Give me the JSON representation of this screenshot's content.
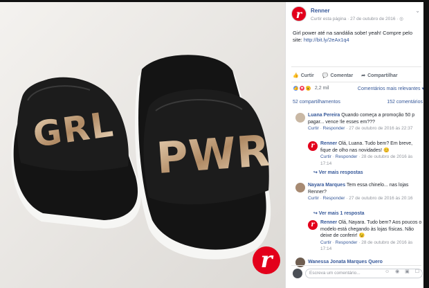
{
  "photo": {
    "logo_letter": "r",
    "left_slide_text": "GRL",
    "right_slide_text": "PWR"
  },
  "post": {
    "page_name": "Renner",
    "meta": "Curtir esta página · 27 de outubro de 2016 · ◎",
    "text_main": "Girl power até na sandália sobe! yeah! Compre pelo site: ",
    "link": "http://bit.ly/2eAx1q4"
  },
  "actions": {
    "like": "Curtir",
    "comment": "Comentar",
    "share": "Compartilhar"
  },
  "reactions": {
    "count": "2,2 mil",
    "sort": "Comentários mais relevantes ▾"
  },
  "shares": {
    "left": "52 compartilhamentos",
    "right": "152 comentários"
  },
  "comments": [
    {
      "name": "Luana Pereira",
      "text": "Quando começa a promoção 50 p pagar... vence !le esses em???",
      "sub_like": "Curtir",
      "sub_reply": "Responder",
      "sub_date": "· 27 de outubro de 2016 às 22:37"
    },
    {
      "name": "Renner",
      "text": "Olá, Luana. Tudo bem? Em breve, fique de olho nas novidades! 😊",
      "sub_like": "Curtir",
      "sub_reply": "Responder",
      "sub_date": "· 28 de outubro de 2016 às 17:14"
    },
    {
      "name": "Nayara Marques",
      "text": "Tem essa chinelo... nas lojas Renner?",
      "sub_like": "Curtir",
      "sub_reply": "Responder",
      "sub_date": "· 27 de outubro de 2016 às 20:16"
    },
    {
      "name": "Renner",
      "text": "Olá, Nayara. Tudo bem? Aos poucos o modelo está chegando às lojas físicas. Não deixe de conferir! 😉",
      "sub_like": "Curtir",
      "sub_reply": "Responder",
      "sub_date": "· 28 de outubro de 2016 às 17:14"
    },
    {
      "name": "Wanessa Jonata Marques Quero",
      "text": ""
    }
  ],
  "more_replies": "↪  Ver mais respostas",
  "one_reply": "↪  Ver mais 1 resposta",
  "compose_placeholder": "Escreva um comentário...",
  "compose_tools": "☺ ◉ ▣ ☐"
}
